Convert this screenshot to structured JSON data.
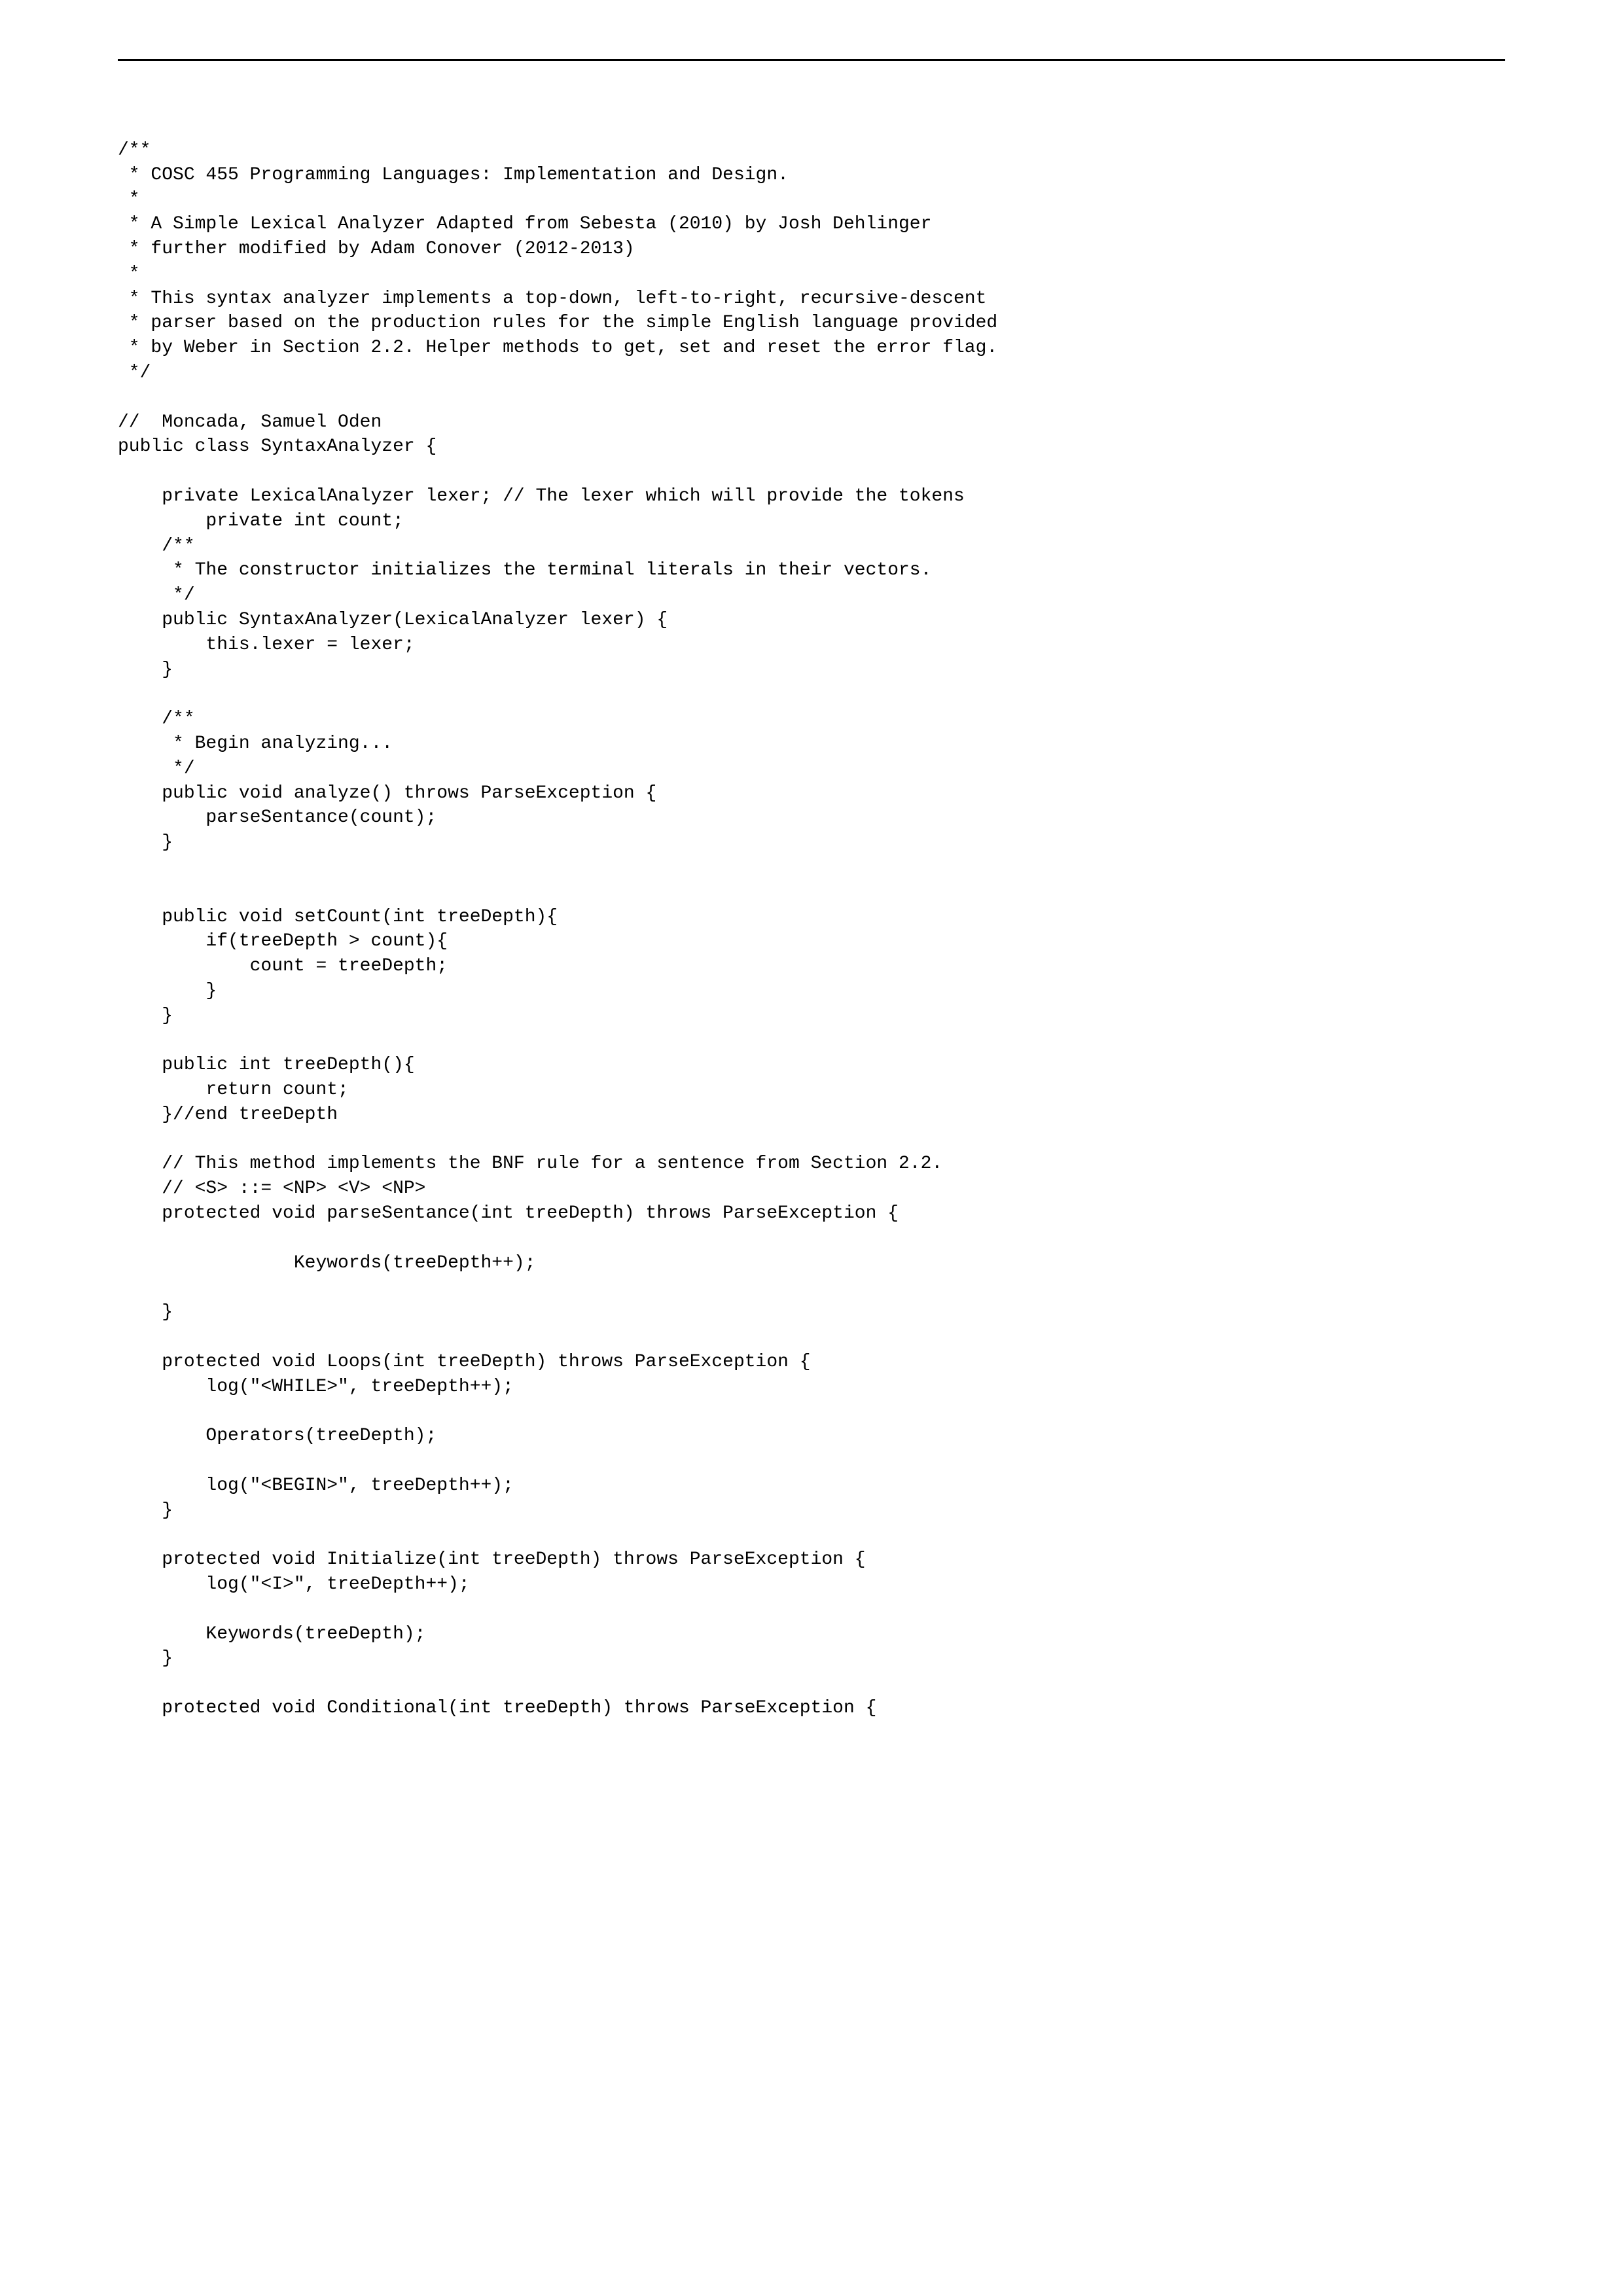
{
  "code_lines": [
    "",
    "/**",
    " * COSC 455 Programming Languages: Implementation and Design.",
    " *",
    " * A Simple Lexical Analyzer Adapted from Sebesta (2010) by Josh Dehlinger",
    " * further modified by Adam Conover (2012-2013)",
    " *",
    " * This syntax analyzer implements a top-down, left-to-right, recursive-descent",
    " * parser based on the production rules for the simple English language provided",
    " * by Weber in Section 2.2. Helper methods to get, set and reset the error flag.",
    " */",
    "",
    "//  Moncada, Samuel Oden",
    "public class SyntaxAnalyzer {",
    "",
    "    private LexicalAnalyzer lexer; // The lexer which will provide the tokens",
    "        private int count;",
    "    /**",
    "     * The constructor initializes the terminal literals in their vectors.",
    "     */",
    "    public SyntaxAnalyzer(LexicalAnalyzer lexer) {",
    "        this.lexer = lexer;",
    "    }",
    "",
    "    /**",
    "     * Begin analyzing...",
    "     */",
    "    public void analyze() throws ParseException {",
    "        parseSentance(count);",
    "    }",
    "",
    "",
    "    public void setCount(int treeDepth){",
    "        if(treeDepth > count){",
    "            count = treeDepth;",
    "        }",
    "    }",
    "",
    "    public int treeDepth(){",
    "        return count;",
    "    }//end treeDepth",
    "",
    "    // This method implements the BNF rule for a sentence from Section 2.2.",
    "    // <S> ::= <NP> <V> <NP>",
    "    protected void parseSentance(int treeDepth) throws ParseException {",
    "",
    "                Keywords(treeDepth++);",
    "",
    "    }",
    "",
    "    protected void Loops(int treeDepth) throws ParseException {",
    "        log(\"<WHILE>\", treeDepth++);",
    "",
    "        Operators(treeDepth);",
    "",
    "        log(\"<BEGIN>\", treeDepth++);",
    "    }",
    "",
    "    protected void Initialize(int treeDepth) throws ParseException {",
    "        log(\"<I>\", treeDepth++);",
    "",
    "        Keywords(treeDepth);",
    "    }",
    "",
    "    protected void Conditional(int treeDepth) throws ParseException {"
  ]
}
